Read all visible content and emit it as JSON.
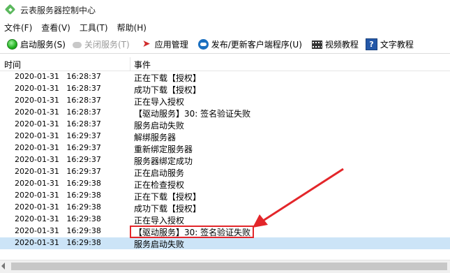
{
  "window": {
    "title": "云表服务器控制中心"
  },
  "menu": [
    "文件(F)",
    "查看(V)",
    "工具(T)",
    "帮助(H)"
  ],
  "toolbar": {
    "start_service": "启动服务(S)",
    "stop_service": "关闭服务(T)",
    "app_management": "应用管理",
    "publish_update": "发布/更新客户端程序(U)",
    "video_tutorial": "视频教程",
    "text_tutorial": "文字教程"
  },
  "list": {
    "columns": [
      "时间",
      "事件"
    ],
    "rows": [
      {
        "time": "2020-01-31   16:28:37",
        "event": "正在下载【授权】"
      },
      {
        "time": "2020-01-31   16:28:37",
        "event": "成功下载【授权】"
      },
      {
        "time": "2020-01-31   16:28:37",
        "event": "正在导入授权"
      },
      {
        "time": "2020-01-31   16:28:37",
        "event": "【驱动服务】30: 签名验证失败"
      },
      {
        "time": "2020-01-31   16:28:37",
        "event": "服务启动失败"
      },
      {
        "time": "2020-01-31   16:29:37",
        "event": "解绑服务器"
      },
      {
        "time": "2020-01-31   16:29:37",
        "event": "重新绑定服务器"
      },
      {
        "time": "2020-01-31   16:29:37",
        "event": "服务器绑定成功"
      },
      {
        "time": "2020-01-31   16:29:37",
        "event": "正在启动服务"
      },
      {
        "time": "2020-01-31   16:29:38",
        "event": "正在检查授权"
      },
      {
        "time": "2020-01-31   16:29:38",
        "event": "正在下载【授权】"
      },
      {
        "time": "2020-01-31   16:29:38",
        "event": "成功下载【授权】"
      },
      {
        "time": "2020-01-31   16:29:38",
        "event": "正在导入授权"
      },
      {
        "time": "2020-01-31   16:29:38",
        "event": "【驱动服务】30: 签名验证失败"
      },
      {
        "time": "2020-01-31   16:29:38",
        "event": "服务启动失败"
      }
    ],
    "selected_index": 14,
    "annotated_index": 13
  },
  "colors": {
    "selection": "#cce4f7",
    "annotation": "#e3262a"
  }
}
